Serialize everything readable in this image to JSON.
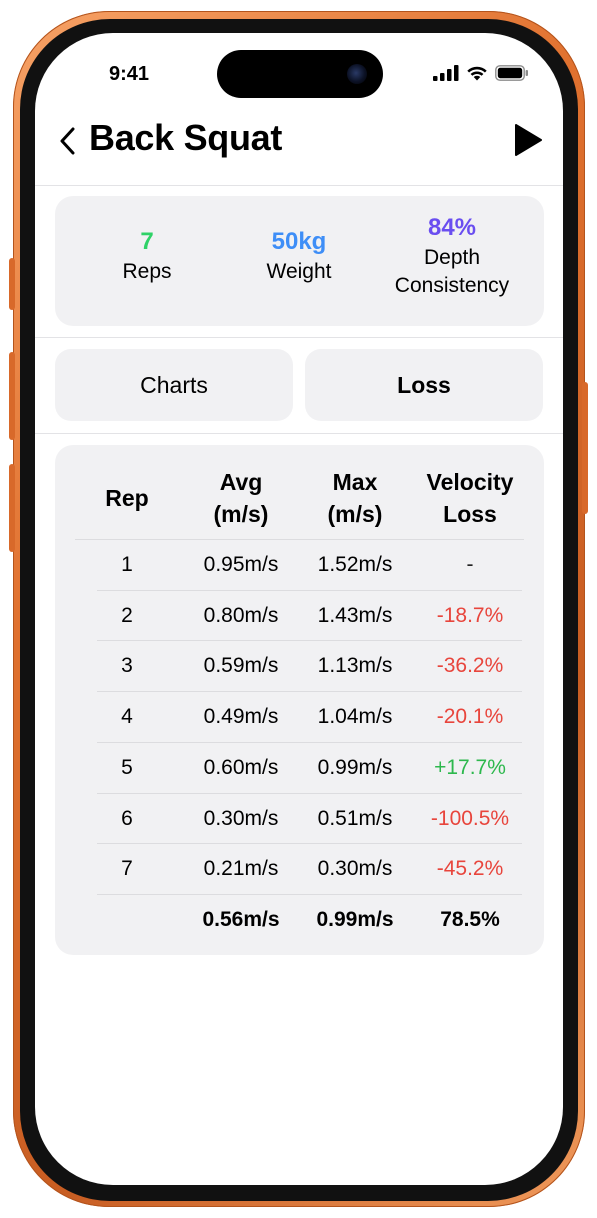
{
  "status": {
    "time": "9:41"
  },
  "header": {
    "title": "Back Squat"
  },
  "stats": [
    {
      "value": "7",
      "label": "Reps",
      "color": "#2fd267"
    },
    {
      "value": "50kg",
      "label": "Weight",
      "color": "#3e8ef7"
    },
    {
      "value": "84%",
      "label_line1": "Depth",
      "label_line2": "Consistency",
      "color": "#6a4ef0"
    }
  ],
  "tabs": {
    "charts": "Charts",
    "loss": "Loss"
  },
  "table": {
    "headers": {
      "rep": "Rep",
      "avg_line1": "Avg",
      "avg_line2": "(m/s)",
      "max_line1": "Max",
      "max_line2": "(m/s)",
      "loss_line1": "Velocity",
      "loss_line2": "Loss"
    },
    "rows": [
      {
        "rep": "1",
        "avg": "0.95m/s",
        "max": "1.52m/s",
        "loss": "-"
      },
      {
        "rep": "2",
        "avg": "0.80m/s",
        "max": "1.43m/s",
        "loss": "-18.7%"
      },
      {
        "rep": "3",
        "avg": "0.59m/s",
        "max": "1.13m/s",
        "loss": "-36.2%"
      },
      {
        "rep": "4",
        "avg": "0.49m/s",
        "max": "1.04m/s",
        "loss": "-20.1%"
      },
      {
        "rep": "5",
        "avg": "0.60m/s",
        "max": "0.99m/s",
        "loss": "+17.7%"
      },
      {
        "rep": "6",
        "avg": "0.30m/s",
        "max": "0.51m/s",
        "loss": "-100.5%"
      },
      {
        "rep": "7",
        "avg": "0.21m/s",
        "max": "0.30m/s",
        "loss": "-45.2%"
      }
    ],
    "totals": {
      "rep": "",
      "avg": "0.56m/s",
      "max": "0.99m/s",
      "loss": "78.5%"
    },
    "colors": {
      "negative": "#e8453c",
      "positive": "#2db84d",
      "neutral": "#222222"
    }
  }
}
